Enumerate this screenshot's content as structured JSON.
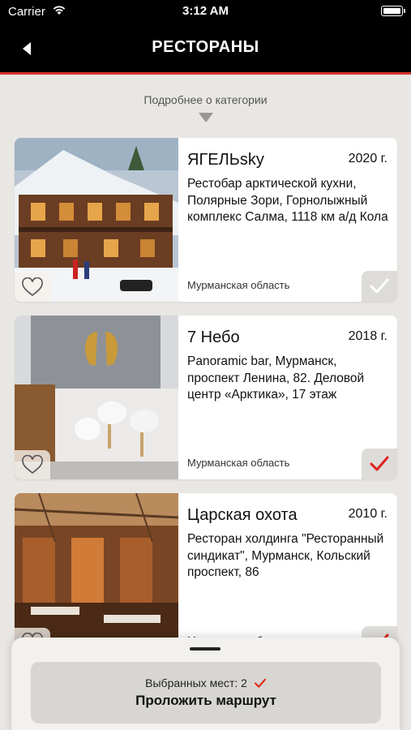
{
  "status_bar": {
    "carrier": "Carrier",
    "time": "3:12 AM"
  },
  "header": {
    "title": "РЕСТОРАНЫ"
  },
  "category_link": "Подробнее о категории",
  "restaurants": [
    {
      "name": "ЯГЕЛЬsky",
      "year": "2020 г.",
      "description": "Рестобар арктической кухни, Полярные Зори, Горнолыжный комплекс Салма, 1118 км а/д Кола",
      "region": "Мурманская область",
      "selected": false
    },
    {
      "name": "7 Небо",
      "year": "2018 г.",
      "description": "Panoramic bar, Мурманск, проспект Ленина, 82. Деловой центр «Арктика», 17 этаж",
      "region": "Мурманская область",
      "selected": true
    },
    {
      "name": "Царская охота",
      "year": "2010 г.",
      "description": "Ресторан холдинга \"Ресторанный синдикат\", Мурманск, Кольский проспект, 86",
      "region": "Мурманская область",
      "selected": true
    }
  ],
  "route_panel": {
    "selected_count_label": "Выбранных мест: 2",
    "button_label": "Проложить маршрут"
  },
  "colors": {
    "accent": "#d6342b",
    "header_bg": "#000000",
    "page_bg": "#e9e7e3"
  },
  "icons": [
    "wifi-icon",
    "battery-icon",
    "back-arrow-icon",
    "triangle-down-icon",
    "heart-icon",
    "checkmark-icon"
  ]
}
